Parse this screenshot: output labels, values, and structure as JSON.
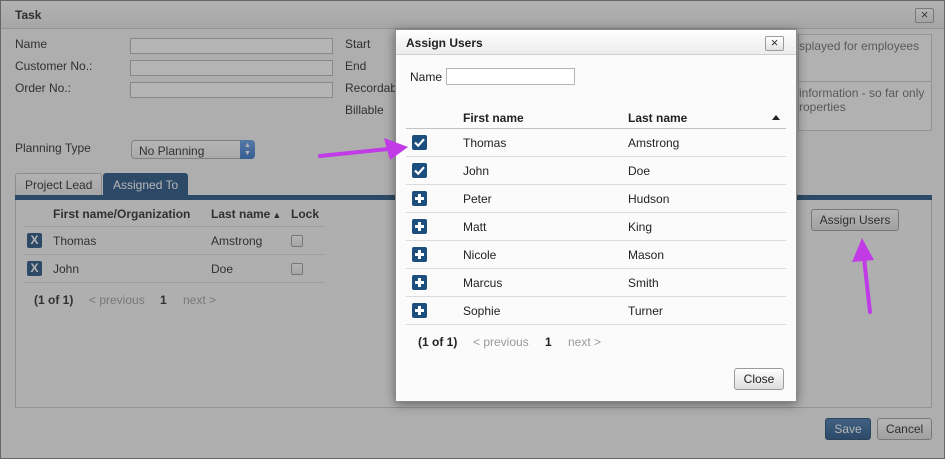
{
  "task": {
    "title": "Task",
    "labels": {
      "name": "Name",
      "customer_no": "Customer No.:",
      "order_no": "Order No.:",
      "start": "Start",
      "end": "End",
      "recordable": "Recordab",
      "billable": "Billable",
      "planning_type": "Planning Type"
    },
    "fields": {
      "name": "",
      "customer_no": "",
      "order_no": ""
    },
    "planning_type_value": "No Planning",
    "info_text_1": "splayed for employees",
    "info_text_2a": "information - so far only",
    "info_text_2b": "roperties",
    "tabs": [
      {
        "label": "Project Lead",
        "active": false
      },
      {
        "label": "Assigned To",
        "active": true
      }
    ],
    "grid": {
      "headers": {
        "name": "First name/Organization",
        "last": "Last name",
        "lock": "Lock"
      },
      "rows": [
        {
          "first": "Thomas",
          "last": "Amstrong"
        },
        {
          "first": "John",
          "last": "Doe"
        }
      ],
      "pager": {
        "count": "(1 of 1)",
        "prev": "< previous",
        "page": "1",
        "next": "next >"
      }
    },
    "assign_users_label": "Assign Users",
    "save_label": "Save",
    "cancel_label": "Cancel"
  },
  "dialog": {
    "title": "Assign Users",
    "name_label": "Name",
    "name_value": "",
    "headers": {
      "first": "First name",
      "last": "Last name"
    },
    "rows": [
      {
        "first": "Thomas",
        "last": "Amstrong",
        "assigned": true
      },
      {
        "first": "John",
        "last": "Doe",
        "assigned": true
      },
      {
        "first": "Peter",
        "last": "Hudson",
        "assigned": false
      },
      {
        "first": "Matt",
        "last": "King",
        "assigned": false
      },
      {
        "first": "Nicole",
        "last": "Mason",
        "assigned": false
      },
      {
        "first": "Marcus",
        "last": "Smith",
        "assigned": false
      },
      {
        "first": "Sophie",
        "last": "Turner",
        "assigned": false
      }
    ],
    "pager": {
      "count": "(1 of 1)",
      "prev": "< previous",
      "page": "1",
      "next": "next >"
    },
    "close_label": "Close"
  },
  "colors": {
    "accent": "#1c4e7e",
    "annotation_arrow": "#c13be6"
  }
}
